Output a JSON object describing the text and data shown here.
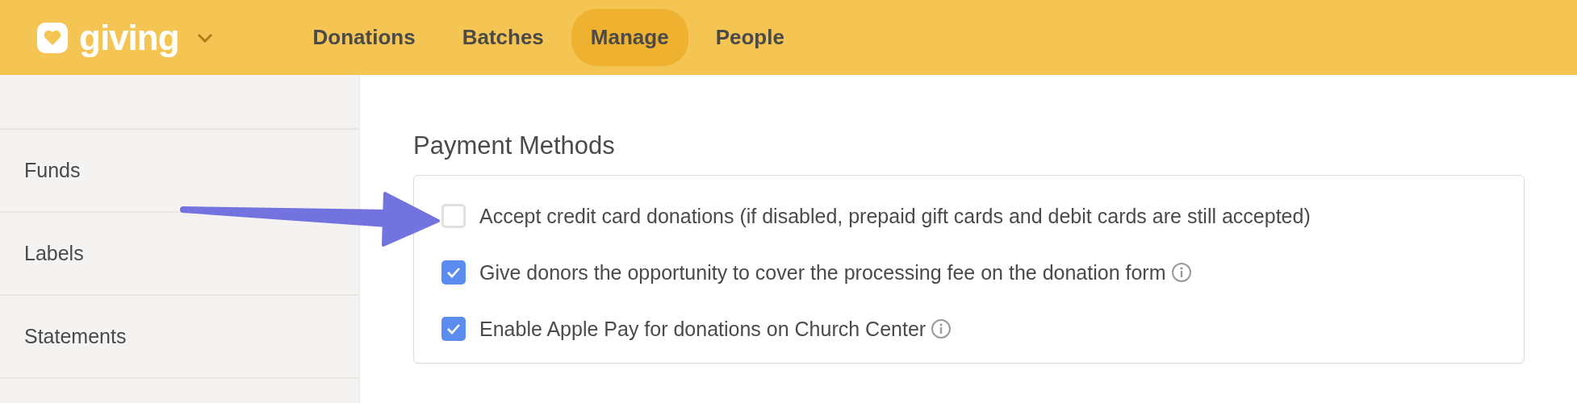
{
  "brand": {
    "name": "giving"
  },
  "nav": [
    {
      "label": "Donations",
      "selected": false
    },
    {
      "label": "Batches",
      "selected": false
    },
    {
      "label": "Manage",
      "selected": true
    },
    {
      "label": "People",
      "selected": false
    }
  ],
  "sidebar": {
    "items": [
      {
        "label": "Funds"
      },
      {
        "label": "Labels"
      },
      {
        "label": "Statements"
      }
    ]
  },
  "section": {
    "title": "Payment Methods",
    "options": [
      {
        "label": "Accept credit card donations (if disabled, prepaid gift cards and debit cards are still accepted)",
        "checked": false,
        "info": false
      },
      {
        "label": "Give donors the opportunity to cover the processing fee on the donation form",
        "checked": true,
        "info": true
      },
      {
        "label": "Enable Apple Pay for donations on Church Center",
        "checked": true,
        "info": true
      }
    ]
  }
}
